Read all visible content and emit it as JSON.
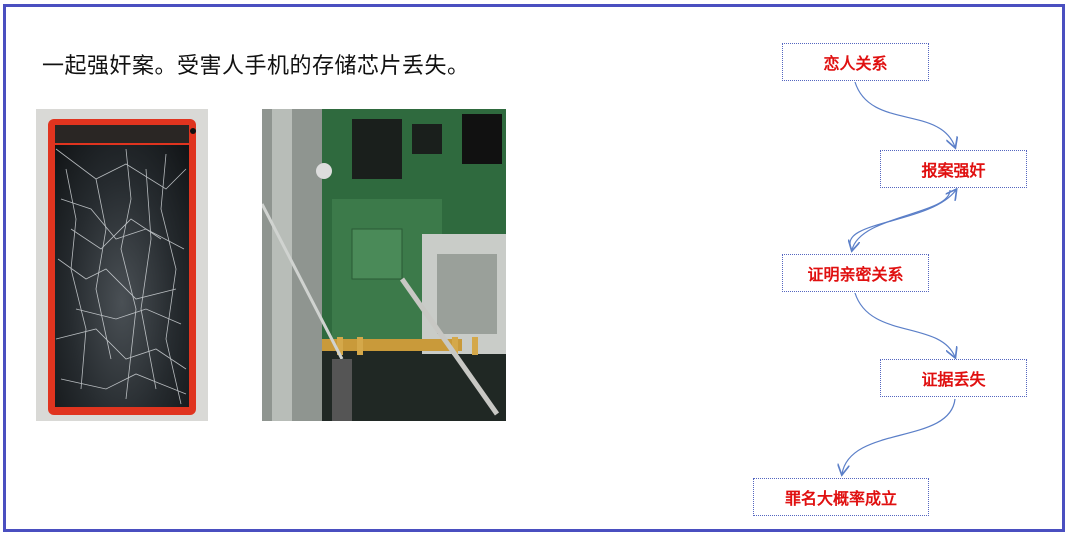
{
  "caption": "一起强奸案。受害人手机的存储芯片丢失。",
  "photos": {
    "broken_phone_label": "broken phone photo",
    "circuit_board_label": "phone circuit board photo"
  },
  "flow": {
    "nodes": [
      {
        "id": "n1",
        "label": "恋人关系"
      },
      {
        "id": "n2",
        "label": "报案强奸"
      },
      {
        "id": "n3",
        "label": "证明亲密关系"
      },
      {
        "id": "n4",
        "label": "证据丢失"
      },
      {
        "id": "n5",
        "label": "罪名大概率成立"
      }
    ]
  },
  "colors": {
    "frame": "#4a4fc0",
    "node_text": "#e01010",
    "arrow": "#5b7fc8"
  }
}
